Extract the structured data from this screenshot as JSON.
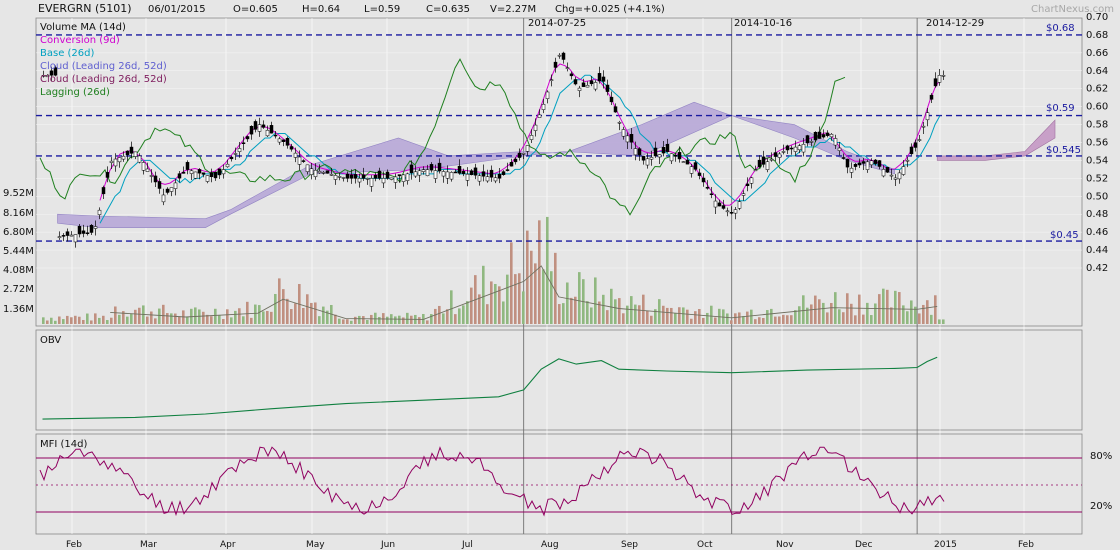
{
  "header": {
    "ticker": "EVERGRN (5101)",
    "date": "06/01/2015",
    "open": "O=0.605",
    "high": "H=0.64",
    "low": "L=0.59",
    "close": "C=0.635",
    "volume": "V=2.27M",
    "change": "Chg=+0.025 (+4.1%)",
    "brand": "ChartNexus.com"
  },
  "legend": [
    {
      "label": "Volume MA (14d)",
      "color": "#444444"
    },
    {
      "label": "Conversion (9d)",
      "color": "#d000d0"
    },
    {
      "label": "Base (26d)",
      "color": "#00a0c0"
    },
    {
      "label": "Cloud (Leading 26d, 52d)",
      "color": "#6060d0"
    },
    {
      "label": "Cloud (Leading 26d, 52d)",
      "color": "#802060"
    },
    {
      "label": "Lagging (26d)",
      "color": "#208020"
    }
  ],
  "markers": [
    "2014-07-25",
    "2014-10-16",
    "2014-12-29"
  ],
  "price_levels": [
    "$0.68",
    "$0.59",
    "$0.545",
    "$0.45"
  ],
  "volume_axis": [
    "9.52M",
    "8.16M",
    "6.80M",
    "5.44M",
    "4.08M",
    "2.72M",
    "1.36M"
  ],
  "panels": {
    "obv": "OBV",
    "mfi": "MFI (14d)",
    "mfi_levels": [
      "80%",
      "20%"
    ]
  },
  "months": [
    "Feb",
    "Mar",
    "Apr",
    "May",
    "Jun",
    "Jul",
    "Aug",
    "Sep",
    "Oct",
    "Nov",
    "Dec",
    "2015",
    "Feb"
  ],
  "colors": {
    "bg": "#e6e6e6",
    "grid": "#ffffff",
    "level": "#1a1aa0",
    "volume_up": "#90b880",
    "volume_down": "#c09080",
    "obv": "#108040",
    "mfi": "#900060"
  },
  "chart_data": {
    "type": "candlestick",
    "price_axis": {
      "min": 0.42,
      "max": 0.7,
      "ticks": [
        0.7,
        0.68,
        0.66,
        0.64,
        0.62,
        0.6,
        0.58,
        0.56,
        0.54,
        0.52,
        0.5,
        0.48,
        0.46,
        0.44,
        0.42
      ]
    },
    "horizontal_levels": [
      0.68,
      0.59,
      0.545,
      0.45
    ],
    "close_series": [
      {
        "x": "2014-01-20",
        "y": 0.455
      },
      {
        "x": "2014-02-03",
        "y": 0.46
      },
      {
        "x": "2014-02-10",
        "y": 0.54
      },
      {
        "x": "2014-02-20",
        "y": 0.55
      },
      {
        "x": "2014-03-03",
        "y": 0.5
      },
      {
        "x": "2014-03-12",
        "y": 0.53
      },
      {
        "x": "2014-03-24",
        "y": 0.52
      },
      {
        "x": "2014-04-01",
        "y": 0.55
      },
      {
        "x": "2014-04-10",
        "y": 0.58
      },
      {
        "x": "2014-04-20",
        "y": 0.56
      },
      {
        "x": "2014-05-01",
        "y": 0.53
      },
      {
        "x": "2014-05-15",
        "y": 0.52
      },
      {
        "x": "2014-06-01",
        "y": 0.52
      },
      {
        "x": "2014-06-15",
        "y": 0.53
      },
      {
        "x": "2014-07-01",
        "y": 0.525
      },
      {
        "x": "2014-07-15",
        "y": 0.52
      },
      {
        "x": "2014-07-25",
        "y": 0.55
      },
      {
        "x": "2014-08-01",
        "y": 0.6
      },
      {
        "x": "2014-08-08",
        "y": 0.66
      },
      {
        "x": "2014-08-15",
        "y": 0.62
      },
      {
        "x": "2014-08-25",
        "y": 0.63
      },
      {
        "x": "2014-09-01",
        "y": 0.58
      },
      {
        "x": "2014-09-10",
        "y": 0.54
      },
      {
        "x": "2014-09-20",
        "y": 0.55
      },
      {
        "x": "2014-10-01",
        "y": 0.53
      },
      {
        "x": "2014-10-10",
        "y": 0.49
      },
      {
        "x": "2014-10-16",
        "y": 0.48
      },
      {
        "x": "2014-10-25",
        "y": 0.53
      },
      {
        "x": "2014-11-05",
        "y": 0.55
      },
      {
        "x": "2014-11-15",
        "y": 0.56
      },
      {
        "x": "2014-11-25",
        "y": 0.57
      },
      {
        "x": "2014-12-01",
        "y": 0.53
      },
      {
        "x": "2014-12-10",
        "y": 0.54
      },
      {
        "x": "2014-12-20",
        "y": 0.52
      },
      {
        "x": "2014-12-29",
        "y": 0.56
      },
      {
        "x": "2015-01-06",
        "y": 0.635
      }
    ],
    "volume_axis": {
      "min": 0,
      "max": 9.52,
      "unit": "M",
      "ticks": [
        9.52,
        8.16,
        6.8,
        5.44,
        4.08,
        2.72,
        1.36
      ]
    },
    "volume_series": [
      {
        "x": "2014-02-10",
        "y": 1.5
      },
      {
        "x": "2014-03-12",
        "y": 0.9
      },
      {
        "x": "2014-04-10",
        "y": 1.4
      },
      {
        "x": "2014-04-20",
        "y": 3.2
      },
      {
        "x": "2014-05-15",
        "y": 0.7
      },
      {
        "x": "2014-06-15",
        "y": 0.6
      },
      {
        "x": "2014-07-25",
        "y": 5.5
      },
      {
        "x": "2014-08-01",
        "y": 7.5
      },
      {
        "x": "2014-08-08",
        "y": 3.5
      },
      {
        "x": "2014-09-01",
        "y": 2.0
      },
      {
        "x": "2014-10-16",
        "y": 0.8
      },
      {
        "x": "2014-11-25",
        "y": 2.1
      },
      {
        "x": "2014-12-29",
        "y": 1.9
      },
      {
        "x": "2015-01-06",
        "y": 2.27
      }
    ],
    "mfi_levels": [
      80,
      20
    ]
  }
}
